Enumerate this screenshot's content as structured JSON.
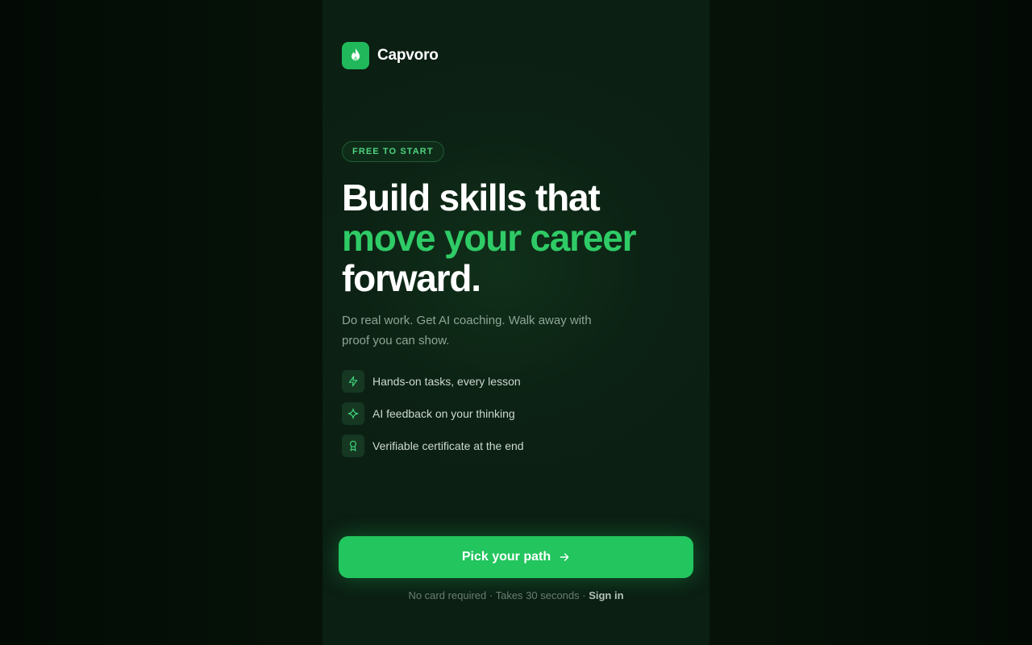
{
  "colors": {
    "accent": "#22c55e",
    "accent_text": "#2fcb66",
    "panel_bg": "#0c2214",
    "outer_bg": "#040c06"
  },
  "brand": {
    "name": "Capvoro",
    "logo_icon": "flame-icon"
  },
  "hero": {
    "badge": "FREE TO START",
    "headline_line1": "Build skills that",
    "headline_line2": "move your career",
    "headline_line3": "forward.",
    "subtitle": "Do real work. Get AI coaching. Walk away with proof you can show."
  },
  "features": [
    {
      "icon": "lightning-icon",
      "label": "Hands-on tasks, every lesson"
    },
    {
      "icon": "sparkle-icon",
      "label": "AI feedback on your thinking"
    },
    {
      "icon": "award-icon",
      "label": "Verifiable certificate at the end"
    }
  ],
  "cta": {
    "label": "Pick your path",
    "icon": "arrow-right-icon"
  },
  "footnote": {
    "text": "No card required · Takes 30 seconds · ",
    "signin_label": "Sign in"
  }
}
